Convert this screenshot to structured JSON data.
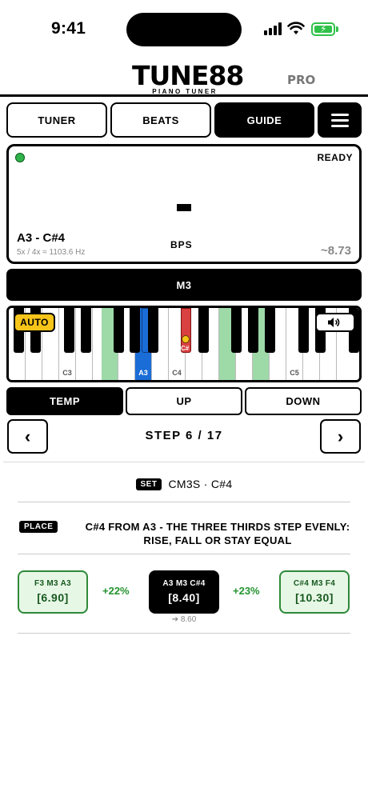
{
  "status": {
    "time": "9:41"
  },
  "logo": {
    "title": "TUNE88",
    "subtitle": "PIANO TUNER",
    "badge": "PRO"
  },
  "tabs": {
    "tuner": "TUNER",
    "beats": "BEATS",
    "guide": "GUIDE",
    "active": "GUIDE"
  },
  "display": {
    "status": "READY",
    "value": "-",
    "interval": "A3 - C#4",
    "ratio": "5x / 4x ≈ 1103.6 Hz",
    "unit": "BPS",
    "beat_rate": "~8.73"
  },
  "interval_name": "M3",
  "keyboard": {
    "auto_label": "AUTO",
    "labels": {
      "c3": "C3",
      "a3": "A3",
      "c4": "C4",
      "c5": "C5",
      "cs4": "C#"
    },
    "highlight_colors": {
      "green": "#9ed9a8",
      "blue": "#1a6dd6",
      "red": "#d94040",
      "marker": "#f7c51a"
    }
  },
  "modes": {
    "temp": "TEMP",
    "up": "UP",
    "down": "DOWN",
    "active": "TEMP"
  },
  "step": {
    "prev": "‹",
    "label": "STEP 6 / 17",
    "next": "›"
  },
  "instructions": {
    "set_tag": "SET",
    "set_text": "CM3S · C#4",
    "place_tag": "PLACE",
    "place_text": "C#4 FROM A3 - THE THREE THIRDS STEP EVENLY: RISE, FALL OR STAY EQUAL"
  },
  "thirds": {
    "left": {
      "name": "F3 M3 A3",
      "value": "[6.90]"
    },
    "left_pct": "+22%",
    "mid": {
      "name": "A3 M3 C#4",
      "value": "[8.40]"
    },
    "right_pct": "+23%",
    "right": {
      "name": "C#4 M3 F4",
      "value": "[10.30]"
    },
    "target": "➔ 8.60"
  }
}
